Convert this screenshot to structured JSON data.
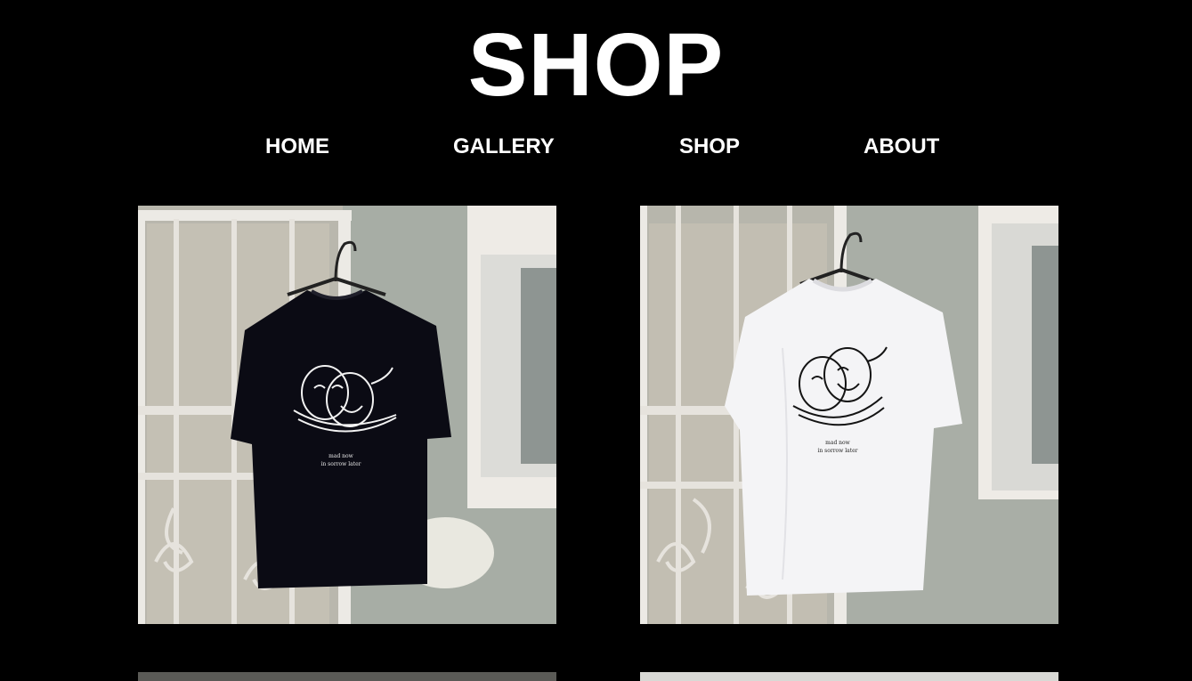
{
  "header": {
    "title": "SHOP"
  },
  "nav": {
    "items": [
      {
        "label": "HOME"
      },
      {
        "label": "GALLERY"
      },
      {
        "label": "SHOP"
      },
      {
        "label": "ABOUT"
      }
    ]
  },
  "products": [
    {
      "shirt_color": "#0b0b14",
      "print_color": "#f2f2f2",
      "caption_line1": "mad now",
      "caption_line2": "in sorrow later"
    },
    {
      "shirt_color": "#f4f4f6",
      "print_color": "#141414",
      "caption_line1": "mad now",
      "caption_line2": "in sorrow later"
    }
  ],
  "colors": {
    "background": "#000000",
    "text": "#ffffff",
    "wall": "#a9aea6",
    "door_frame": "#ece9e4"
  }
}
